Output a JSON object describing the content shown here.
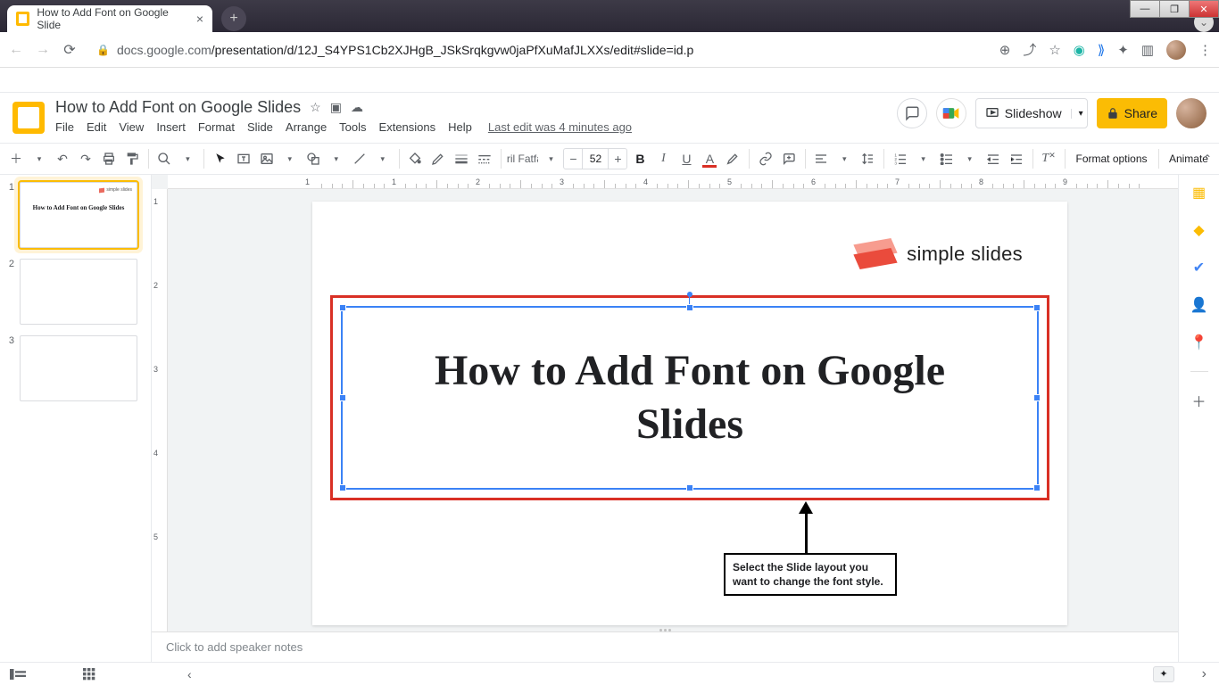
{
  "browser": {
    "tab_title": "How to Add Font on Google Slide",
    "url_host": "docs.google.com",
    "url_path": "/presentation/d/12J_S4YPS1Cb2XJHgB_JSkSrqkgvw0jaPfXuMafJLXXs/edit#slide=id.p"
  },
  "header": {
    "doc_title": "How to Add Font on  Google Slides",
    "menus": [
      "File",
      "Edit",
      "View",
      "Insert",
      "Format",
      "Slide",
      "Arrange",
      "Tools",
      "Extensions",
      "Help"
    ],
    "last_edit": "Last edit was 4 minutes ago",
    "slideshow_label": "Slideshow",
    "share_label": "Share"
  },
  "toolbar": {
    "font_name": "Abril Fatfa...",
    "font_size": "52",
    "format_options": "Format options",
    "animate": "Animate"
  },
  "ruler_h": [
    "1",
    "",
    "1",
    "2",
    "3",
    "4",
    "5",
    "6",
    "7",
    "8",
    "9"
  ],
  "ruler_v": [
    "",
    "1",
    "2",
    "3",
    "4",
    "5"
  ],
  "thumbs": [
    {
      "num": "1",
      "title": "How to Add Font on Google Slides",
      "logo": "simple slides",
      "active": true
    },
    {
      "num": "2",
      "title": "",
      "logo": "",
      "active": false
    },
    {
      "num": "3",
      "title": "",
      "logo": "",
      "active": false
    }
  ],
  "slide": {
    "logo_text": "simple slides",
    "title_text": "How to Add Font on Google Slides",
    "annotation": "Select the Slide layout you want to change the font style."
  },
  "notes_placeholder": "Click to add speaker notes"
}
